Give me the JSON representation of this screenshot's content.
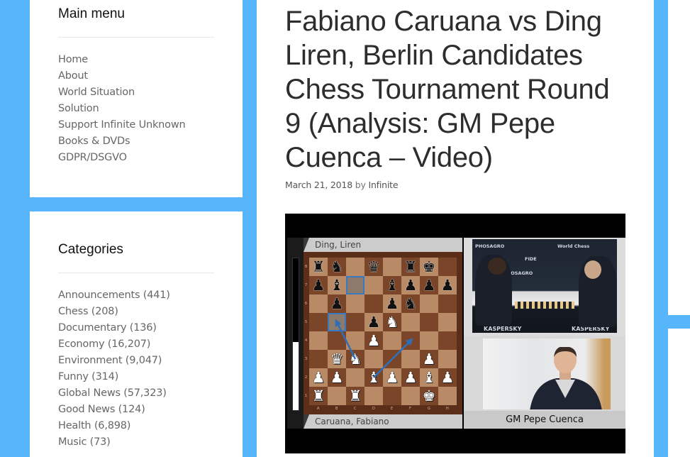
{
  "sidebar": {
    "main_menu": {
      "title": "Main menu",
      "items": [
        {
          "label": "Home"
        },
        {
          "label": "About"
        },
        {
          "label": "World Situation"
        },
        {
          "label": "Solution"
        },
        {
          "label": "Support Infinite Unknown"
        },
        {
          "label": "Books & DVDs"
        },
        {
          "label": "GDPR/DSGVO"
        }
      ]
    },
    "categories": {
      "title": "Categories",
      "items": [
        {
          "label": "Announcements",
          "count": "(441)"
        },
        {
          "label": "Chess",
          "count": "(208)"
        },
        {
          "label": "Documentary",
          "count": "(136)"
        },
        {
          "label": "Economy",
          "count": "(16,207)"
        },
        {
          "label": "Environment",
          "count": "(9,047)"
        },
        {
          "label": "Funny",
          "count": "(314)"
        },
        {
          "label": "Global News",
          "count": "(57,323)"
        },
        {
          "label": "Good News",
          "count": "(124)"
        },
        {
          "label": "Health",
          "count": "(6,898)"
        },
        {
          "label": "Music",
          "count": "(73)"
        }
      ]
    }
  },
  "post": {
    "title": "Fabiano Caruana vs Ding Liren, Berlin Candidates Chess Tournament Round 9 (Analysis: GM Pepe Cuenca – Video)",
    "date": "March 21, 2018",
    "by": "by",
    "author": "Infinite"
  },
  "video": {
    "player_top": "Ding, Liren",
    "player_bottom": "Caruana, Fabiano",
    "commentator": "GM Pepe Cuenca",
    "eval_black_fraction": 0.55,
    "files": [
      "A",
      "B",
      "C",
      "D",
      "E",
      "F",
      "G",
      "H"
    ],
    "ranks": [
      "8",
      "7",
      "6",
      "5",
      "4",
      "3",
      "2",
      "1"
    ],
    "board": [
      [
        "r",
        "n",
        "",
        "q",
        "",
        "r",
        "k",
        ""
      ],
      [
        "p",
        "b",
        "",
        "",
        "b",
        "p",
        "p",
        "p"
      ],
      [
        "",
        "p",
        "",
        "",
        "p",
        "n",
        "",
        ""
      ],
      [
        "",
        "",
        "",
        "p",
        "N",
        "",
        "",
        ""
      ],
      [
        "",
        "",
        "",
        "P",
        "",
        "",
        "",
        ""
      ],
      [
        "",
        "Q",
        "N",
        "",
        "",
        "",
        "P",
        ""
      ],
      [
        "P",
        "P",
        "",
        "B",
        "P",
        "P",
        "B",
        "P"
      ],
      [
        "R",
        "",
        "R",
        "",
        "",
        "",
        "K",
        ""
      ]
    ],
    "highlights": [
      "c7",
      "b5"
    ],
    "arrows": [
      {
        "from": "c3",
        "to": "b5"
      },
      {
        "from": "d2",
        "to": "f4"
      }
    ],
    "arrow_color": "#2f6fb8",
    "sponsors": [
      "PHOSAGRO",
      "World Chess",
      "FIDE",
      "KASPERSKY"
    ]
  },
  "colors": {
    "background": "#56b5fb",
    "panel": "#ffffff"
  }
}
